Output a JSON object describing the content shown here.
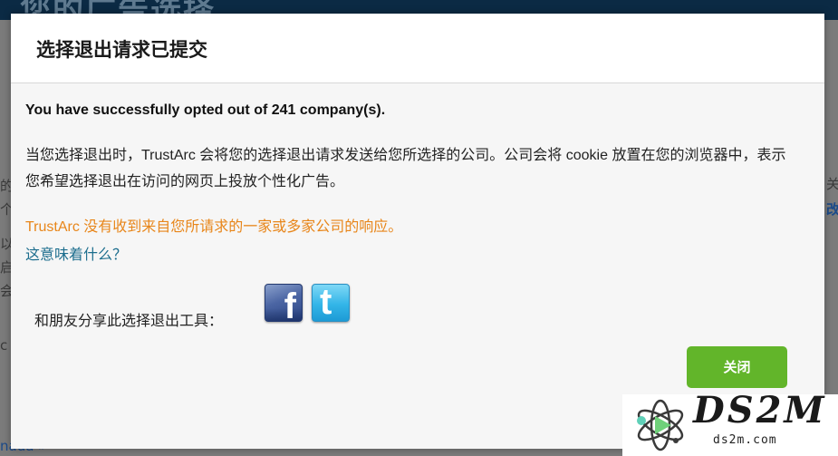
{
  "background": {
    "header_title": "您的广告选择",
    "fragments": {
      "left_1": "的",
      "left_2": "个",
      "left_3": "以",
      "left_4": "启",
      "left_5": "会",
      "left_6": "c",
      "left_bottom": "nada »",
      "right_1": "关于",
      "right_2": "改"
    }
  },
  "modal": {
    "title": "选择退出请求已提交",
    "success_message": "You have successfully opted out of 241 company(s).",
    "explanation": "当您选择退出时，TrustArc 会将您的选择退出请求发送给您所选择的公司。公司会将 cookie 放置在您的浏览器中，表示您希望选择退出在访问的网页上投放个性化广告。",
    "notice": "TrustArc 没有收到来自您所请求的一家或多家公司的响应。",
    "what_link": "这意味着什么？",
    "share_label": "和朋友分享此选择退出工具：",
    "share_icons": [
      "facebook-icon",
      "twitter-icon"
    ],
    "close_button": "关闭"
  },
  "watermark": {
    "brand": "DS2M",
    "site": "ds2m.com"
  },
  "colors": {
    "notice_orange": "#e8861a",
    "link_teal": "#1d6e8e",
    "close_green": "#62b52a",
    "header_navy": "#0b2a44"
  }
}
